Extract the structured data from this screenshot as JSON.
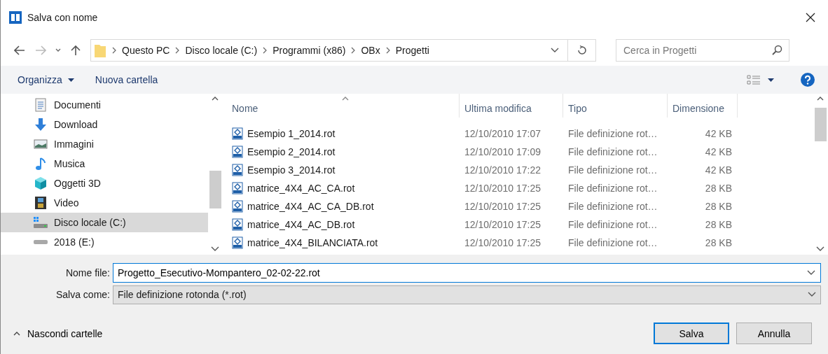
{
  "window": {
    "title": "Salva con nome"
  },
  "address": {
    "path": [
      "Questo PC",
      "Disco locale (C:)",
      "Programmi (x86)",
      "OBx",
      "Progetti"
    ]
  },
  "search": {
    "placeholder": "Cerca in Progetti"
  },
  "toolbar": {
    "buttons": [
      {
        "label": "Organizza",
        "kind": "menu"
      },
      {
        "label": "Nuova cartella",
        "kind": "plain"
      }
    ]
  },
  "sidebar": {
    "items": [
      {
        "label": "Documenti",
        "kind": "documents",
        "selected": false
      },
      {
        "label": "Download",
        "kind": "download",
        "selected": false
      },
      {
        "label": "Immagini",
        "kind": "pictures",
        "selected": false
      },
      {
        "label": "Musica",
        "kind": "music",
        "selected": false
      },
      {
        "label": "Oggetti 3D",
        "kind": "objects",
        "selected": false
      },
      {
        "label": "Video",
        "kind": "video",
        "selected": false
      },
      {
        "label": "Disco locale (C:)",
        "kind": "systemdrive",
        "selected": true
      },
      {
        "label": "2018 (E:)",
        "kind": "drive",
        "selected": false
      }
    ]
  },
  "table": {
    "columns": [
      {
        "label": "Nome",
        "sorted": true
      },
      {
        "label": "Ultima modifica",
        "sorted": false
      },
      {
        "label": "Tipo",
        "sorted": false
      },
      {
        "label": "Dimensione",
        "sorted": false
      }
    ],
    "rows": [
      {
        "name": "Esempio 1_2014.rot",
        "modified": "12/10/2010 17:07",
        "type": "File definizione rot…",
        "size": "42 KB"
      },
      {
        "name": "Esempio 2_2014.rot",
        "modified": "12/10/2010 17:09",
        "type": "File definizione rot…",
        "size": "42 KB"
      },
      {
        "name": "Esempio 3_2014.rot",
        "modified": "12/10/2010 17:22",
        "type": "File definizione rot…",
        "size": "42 KB"
      },
      {
        "name": "matrice_4X4_AC_CA.rot",
        "modified": "12/10/2010 17:25",
        "type": "File definizione rot…",
        "size": "28 KB"
      },
      {
        "name": "matrice_4X4_AC_CA_DB.rot",
        "modified": "12/10/2010 17:25",
        "type": "File definizione rot…",
        "size": "28 KB"
      },
      {
        "name": "matrice_4X4_AC_DB.rot",
        "modified": "12/10/2010 17:25",
        "type": "File definizione rot…",
        "size": "28 KB"
      },
      {
        "name": "matrice_4X4_BILANCIATA.rot",
        "modified": "12/10/2010 17:25",
        "type": "File definizione rot…",
        "size": "28 KB"
      }
    ]
  },
  "form": {
    "filename": {
      "label": "Nome file:",
      "value": "Progetto_Esecutivo-Mompantero_02-02-22.rot"
    },
    "filetype": {
      "label": "Salva come:",
      "value": "File definizione rotonda (*.rot)"
    }
  },
  "footer": {
    "toggle": "Nascondi cartelle",
    "buttons": [
      {
        "label": "Salva",
        "default": true
      },
      {
        "label": "Annulla",
        "default": false
      }
    ]
  }
}
